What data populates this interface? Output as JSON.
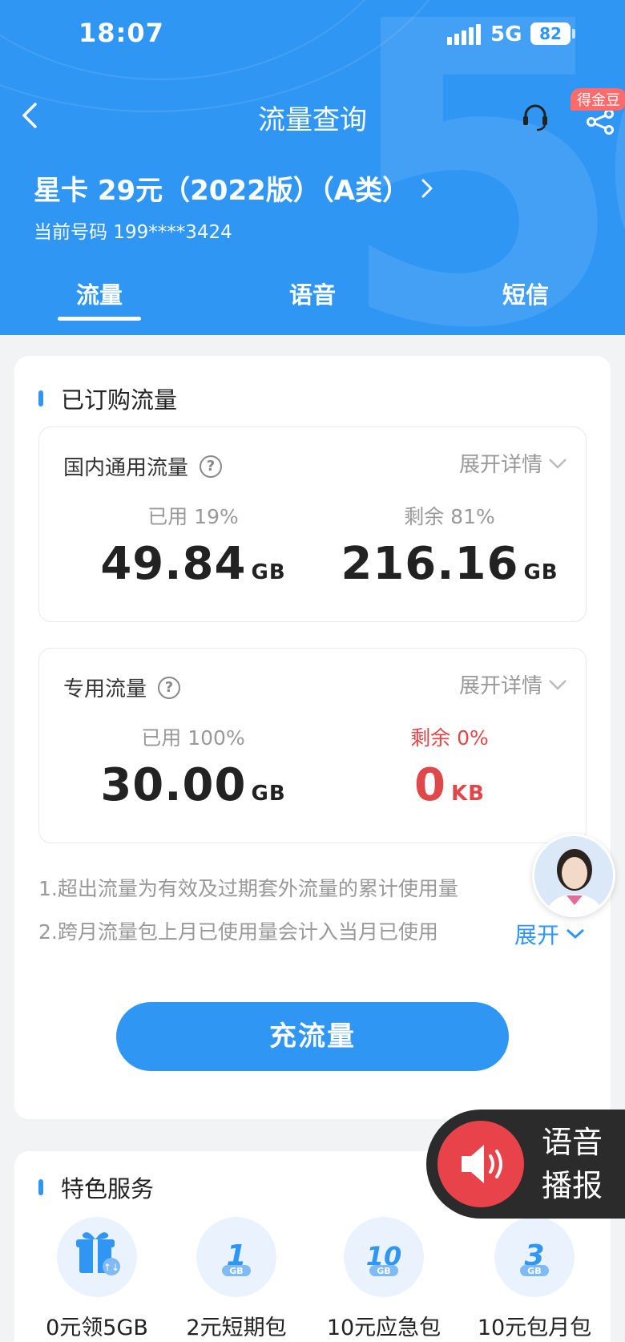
{
  "status_bar": {
    "time": "18:07",
    "network": "5G",
    "battery": "82"
  },
  "nav": {
    "title": "流量查询",
    "badge": "得金豆"
  },
  "plan": {
    "name": "星卡 29元（2022版）（A类）",
    "phone": "当前号码 199****3424"
  },
  "tabs": [
    {
      "label": "流量"
    },
    {
      "label": "语音"
    },
    {
      "label": "短信"
    }
  ],
  "subscribed": {
    "title": "已订购流量",
    "domestic": {
      "label": "国内通用流量",
      "expand": "展开详情",
      "used_label": "已用 19%",
      "used_value": "49.84",
      "used_unit": "GB",
      "remain_label": "剩余 81%",
      "remain_value": "216.16",
      "remain_unit": "GB"
    },
    "dedicated": {
      "label": "专用流量",
      "expand": "展开详情",
      "used_label": "已用 100%",
      "used_value": "30.00",
      "used_unit": "GB",
      "remain_label": "剩余 0%",
      "remain_value": "0",
      "remain_unit": "KB"
    },
    "notes": [
      "1.超出流量为有效及过期套外流量的累计使用量",
      "2.跨月流量包上月已使用量会计入当月已使用"
    ],
    "expand_link": "展开",
    "recharge_button": "充流量"
  },
  "voice_float": {
    "line1": "语音",
    "line2": "播报"
  },
  "services": {
    "title": "特色服务",
    "items": [
      {
        "label": "0元领5GB",
        "icon": "gift-icon"
      },
      {
        "label": "2元短期包",
        "icon": "1gb-icon",
        "badge_num": "1",
        "badge_unit": "GB"
      },
      {
        "label": "10元应急包",
        "icon": "10gb-icon",
        "badge_num": "10",
        "badge_unit": "GB"
      },
      {
        "label": "10元包月包",
        "icon": "3gb-icon",
        "badge_num": "3",
        "badge_unit": "GB"
      }
    ]
  },
  "colors": {
    "primary": "#2f96f3",
    "danger": "#e0474b",
    "background": "#f2f3f5"
  }
}
